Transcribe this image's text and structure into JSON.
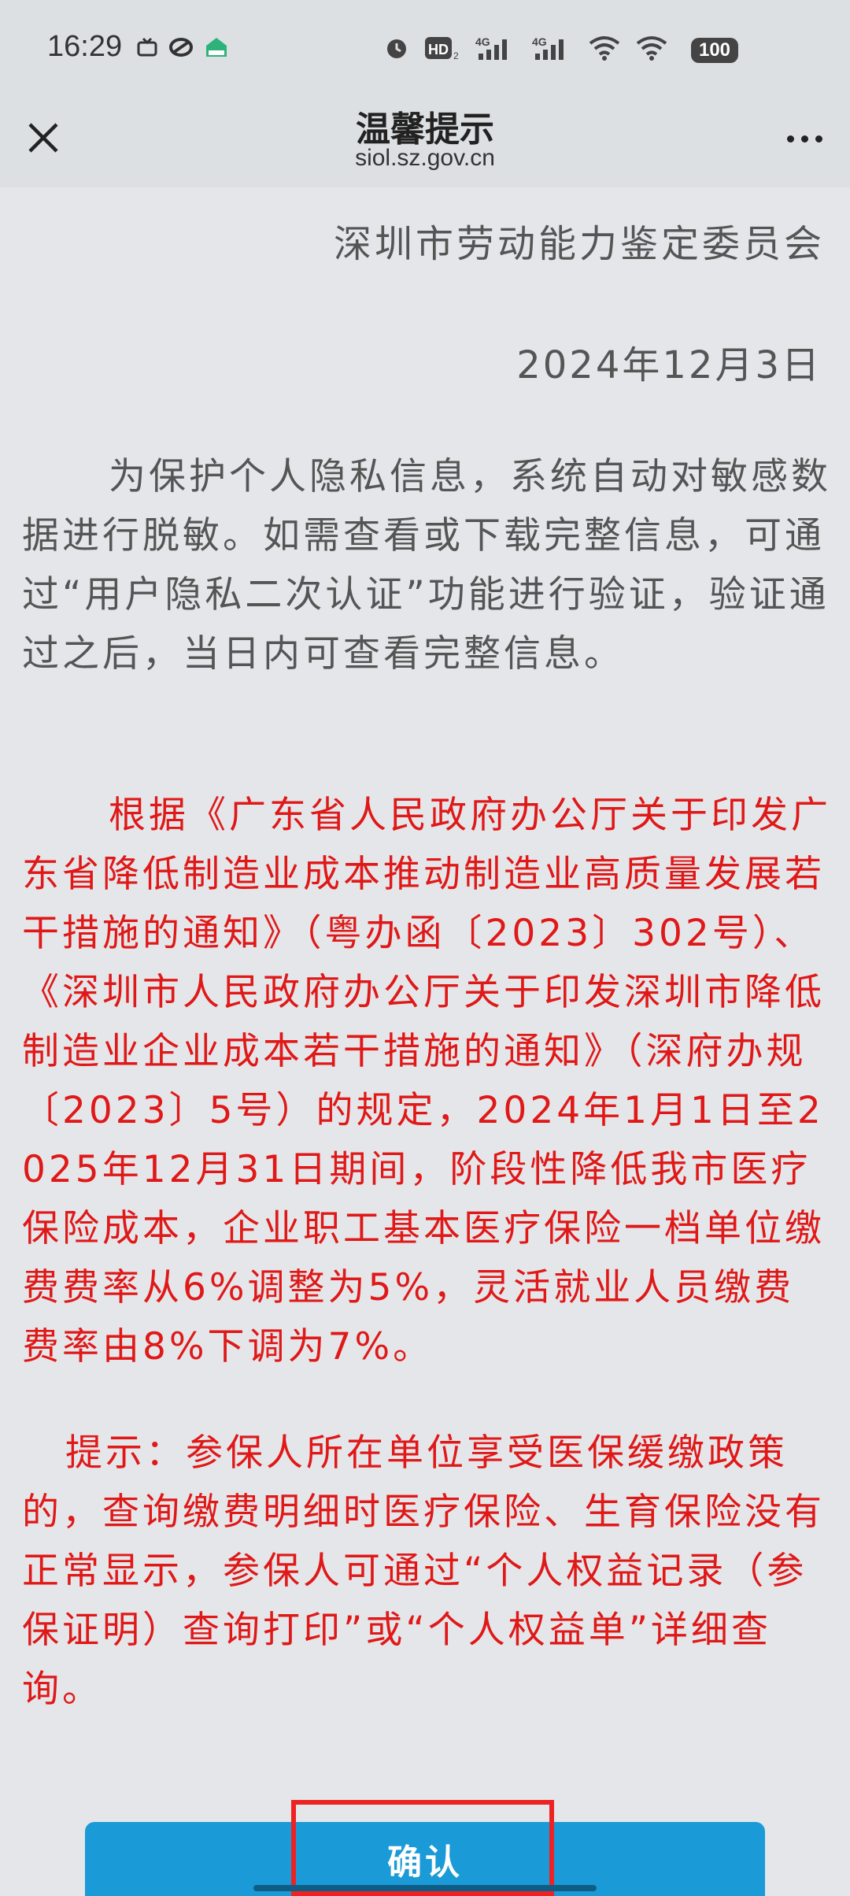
{
  "status_bar": {
    "time": "16:29",
    "battery": "100",
    "network_1": "4G",
    "network_2": "4G",
    "hd_label": "HD",
    "icons": [
      "tv-icon",
      "link-icon",
      "home-app-icon",
      "alarm-icon",
      "hd-icon",
      "signal-icon",
      "signal-icon",
      "wifi-icon",
      "wifi-icon",
      "battery-icon"
    ]
  },
  "nav": {
    "title": "温馨提示",
    "subtitle": "siol.sz.gov.cn",
    "close_icon": "close-icon",
    "more_icon": "more-icon"
  },
  "notice": {
    "organization": "深圳市劳动能力鉴定委员会",
    "date": "2024年12月3日",
    "paragraph_1": "为保护个人隐私信息，系统自动对敏感数据进行脱敏。如需查看或下载完整信息，可通过“用户隐私二次认证”功能进行验证，验证通过之后，当日内可查看完整信息。",
    "paragraph_2": "根据《广东省人民政府办公厅关于印发广东省降低制造业成本推动制造业高质量发展若干措施的通知》（粤办函〔2023〕302号）、《深圳市人民政府办公厅关于印发深圳市降低制造业企业成本若干措施的通知》（深府办规〔2023〕5号）的规定，2024年1月1日至2025年12月31日期间，阶段性降低我市医疗保险成本，企业职工基本医疗保险一档单位缴费费率从6%调整为5%，灵活就业人员缴费费率由8%下调为7%。",
    "paragraph_3": "提示：参保人所在单位享受医保缓缴政策的，查询缴费明细时医疗保险、生育保险没有正常显示，参保人可通过“个人权益记录（参保证明）查询打印”或“个人权益单”详细查询。"
  },
  "confirm_button": {
    "label": "确认"
  },
  "colors": {
    "accent": "#1a9ad6",
    "notice_red": "#e01818",
    "highlight": "#ee2222"
  }
}
